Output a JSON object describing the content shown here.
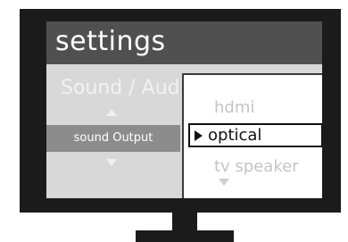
{
  "screen": {
    "title": "settings",
    "section": "Sound / Aud",
    "setting_label": "sound Output"
  },
  "dropdown": {
    "options": [
      "hdmi",
      "optical",
      "tv speaker"
    ],
    "selected": "optical"
  },
  "icons": {
    "up": "chevron-up-icon",
    "down": "chevron-down-icon",
    "selected": "play-caret-icon",
    "scroll": "scroll-down-icon"
  },
  "colors": {
    "title_bar": "#505050",
    "screen_bg": "#d8d8d8",
    "selected_row": "#8c8c8c",
    "bezel": "#1b1b1b"
  }
}
